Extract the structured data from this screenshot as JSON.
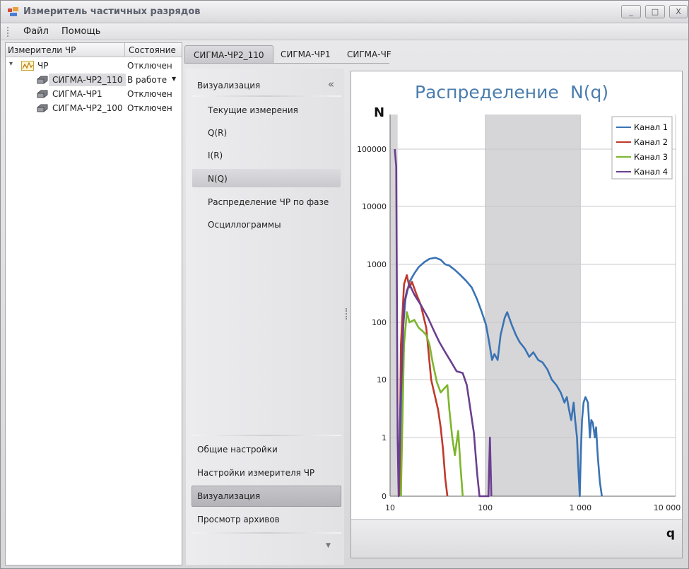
{
  "window": {
    "title": "Измеритель частичных разрядов",
    "controls": {
      "minimize": "_",
      "maximize": "□",
      "close": "X"
    }
  },
  "menu": {
    "items": [
      "Файл",
      "Помощь"
    ]
  },
  "tree": {
    "columns": [
      "Измерители ЧР",
      "Состояние"
    ],
    "rows": [
      {
        "name": "ЧР",
        "state": "Отключен",
        "level": 0,
        "expander": "▾"
      },
      {
        "name": "СИГМА-ЧР2_110",
        "state": "В работе",
        "level": 1,
        "selected": true,
        "dropdown": "▼"
      },
      {
        "name": "СИГМА-ЧР1",
        "state": "Отключен",
        "level": 1
      },
      {
        "name": "СИГМА-ЧР2_100",
        "state": "Отключен",
        "level": 1
      }
    ]
  },
  "tabs": [
    {
      "label": "СИГМА-ЧР2_110",
      "active": true
    },
    {
      "label": "СИГМА-ЧР1",
      "active": false
    },
    {
      "label": "СИГМА-ЧF",
      "active": false
    }
  ],
  "nav": {
    "header": "Визуализация",
    "collapse_glyph": "«",
    "items": [
      "Текущие измерения",
      "Q(R)",
      "I(R)",
      "N(Q)",
      "Распределение ЧР по фазе",
      "Осциллограммы"
    ],
    "selected_item": "N(Q)",
    "bottom_items": [
      "Общие настройки",
      "Настройки измерителя ЧР",
      "Визуализация",
      "Просмотр архивов"
    ],
    "selected_bottom": "Визуализация",
    "scroll_down_glyph": "▼"
  },
  "chart_data": {
    "type": "line",
    "title": "Распределение",
    "title_suffix": "N(q)",
    "ylabel": "N",
    "xlabel": "q",
    "x_scale": "log",
    "y_scale": "log",
    "x_ticks": [
      "10",
      "100",
      "1 000",
      "10 000"
    ],
    "y_ticks": [
      "0",
      "1",
      "10",
      "100",
      "1000",
      "10000",
      "100000"
    ],
    "shaded_bands": [
      [
        10,
        12
      ],
      [
        100,
        1000
      ]
    ],
    "legend_position": "top-right",
    "grid": true,
    "series": [
      {
        "name": "Канал 1",
        "color": "#3a73b4",
        "points": [
          [
            13,
            0
          ],
          [
            13.5,
            60
          ],
          [
            14.5,
            250
          ],
          [
            16,
            500
          ],
          [
            18,
            700
          ],
          [
            20,
            900
          ],
          [
            23,
            1100
          ],
          [
            26,
            1250
          ],
          [
            30,
            1300
          ],
          [
            34,
            1200
          ],
          [
            38,
            1000
          ],
          [
            42,
            950
          ],
          [
            48,
            800
          ],
          [
            55,
            650
          ],
          [
            63,
            520
          ],
          [
            72,
            400
          ],
          [
            82,
            250
          ],
          [
            92,
            150
          ],
          [
            102,
            90
          ],
          [
            110,
            45
          ],
          [
            118,
            22
          ],
          [
            125,
            28
          ],
          [
            135,
            22
          ],
          [
            145,
            60
          ],
          [
            160,
            120
          ],
          [
            170,
            150
          ],
          [
            190,
            90
          ],
          [
            210,
            60
          ],
          [
            230,
            45
          ],
          [
            260,
            35
          ],
          [
            290,
            25
          ],
          [
            320,
            30
          ],
          [
            360,
            22
          ],
          [
            400,
            20
          ],
          [
            450,
            15
          ],
          [
            500,
            10
          ],
          [
            560,
            8
          ],
          [
            620,
            6
          ],
          [
            680,
            4
          ],
          [
            720,
            5
          ],
          [
            760,
            3
          ],
          [
            800,
            2
          ],
          [
            850,
            4
          ],
          [
            880,
            2
          ],
          [
            920,
            1
          ],
          [
            950,
            0.5
          ],
          [
            985,
            0
          ],
          [
            1010,
            0.7
          ],
          [
            1040,
            2
          ],
          [
            1080,
            4
          ],
          [
            1130,
            5
          ],
          [
            1200,
            4
          ],
          [
            1260,
            1
          ],
          [
            1300,
            2
          ],
          [
            1350,
            1.8
          ],
          [
            1420,
            1
          ],
          [
            1460,
            1.5
          ],
          [
            1520,
            0.7
          ],
          [
            1600,
            0.25
          ],
          [
            1680,
            0
          ]
        ]
      },
      {
        "name": "Канал 2",
        "color": "#c0392b",
        "points": [
          [
            12.5,
            0
          ],
          [
            13,
            40
          ],
          [
            14,
            450
          ],
          [
            15,
            650
          ],
          [
            16,
            400
          ],
          [
            17,
            500
          ],
          [
            19,
            300
          ],
          [
            21,
            200
          ],
          [
            24,
            80
          ],
          [
            27,
            10
          ],
          [
            29,
            6
          ],
          [
            32,
            3
          ],
          [
            34,
            1.5
          ],
          [
            36,
            0.8
          ],
          [
            38,
            0.3
          ],
          [
            40,
            0
          ]
        ]
      },
      {
        "name": "Канал 3",
        "color": "#7db62c",
        "points": [
          [
            13,
            0
          ],
          [
            14,
            40
          ],
          [
            15,
            150
          ],
          [
            16,
            100
          ],
          [
            18,
            110
          ],
          [
            20,
            80
          ],
          [
            22,
            70
          ],
          [
            24,
            60
          ],
          [
            26,
            40
          ],
          [
            28,
            20
          ],
          [
            31,
            9
          ],
          [
            34,
            6
          ],
          [
            37,
            7
          ],
          [
            40,
            8
          ],
          [
            42,
            3
          ],
          [
            45,
            1
          ],
          [
            48,
            0.7
          ],
          [
            52,
            1.3
          ],
          [
            55,
            0.5
          ],
          [
            58,
            0
          ]
        ]
      },
      {
        "name": "Канал 4",
        "color": "#6b3f8f",
        "points": [
          [
            11.2,
            100000
          ],
          [
            11.6,
            50000
          ],
          [
            12,
            1
          ],
          [
            12.3,
            0
          ],
          [
            12.8,
            3
          ],
          [
            13.2,
            10
          ],
          [
            14,
            200
          ],
          [
            15,
            350
          ],
          [
            16,
            450
          ],
          [
            18,
            300
          ],
          [
            21,
            200
          ],
          [
            25,
            120
          ],
          [
            29,
            70
          ],
          [
            33,
            45
          ],
          [
            38,
            30
          ],
          [
            44,
            20
          ],
          [
            50,
            14
          ],
          [
            58,
            13
          ],
          [
            64,
            8
          ],
          [
            70,
            3
          ],
          [
            76,
            1.2
          ],
          [
            82,
            0.4
          ],
          [
            87,
            0
          ],
          [
            108,
            0
          ],
          [
            112,
            1.0
          ],
          [
            116,
            0
          ]
        ]
      }
    ]
  }
}
